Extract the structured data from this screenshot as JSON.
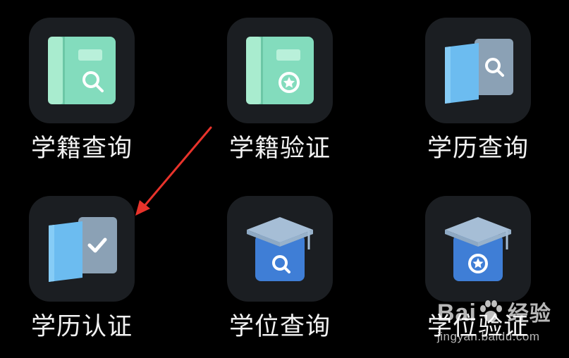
{
  "tiles": [
    {
      "label": "学籍查询",
      "icon": "green-book-search-icon"
    },
    {
      "label": "学籍验证",
      "icon": "green-book-verify-icon"
    },
    {
      "label": "学历查询",
      "icon": "blue-folder-search-icon"
    },
    {
      "label": "学历认证",
      "icon": "blue-folder-check-icon"
    },
    {
      "label": "学位查询",
      "icon": "grad-cap-search-icon"
    },
    {
      "label": "学位验证",
      "icon": "grad-cap-verify-icon"
    }
  ],
  "watermark": {
    "brand": "Bai",
    "suffix": "经验",
    "url": "jingyan.baidu.com"
  },
  "colors": {
    "background": "#000000",
    "tile_bg": "#1b1e22",
    "label": "#f2f2f2",
    "green_icon": "#7dd5b4",
    "blue_icon": "#5aa7e6",
    "cap_blue": "#3f7ed6",
    "arrow": "#e8332b"
  }
}
